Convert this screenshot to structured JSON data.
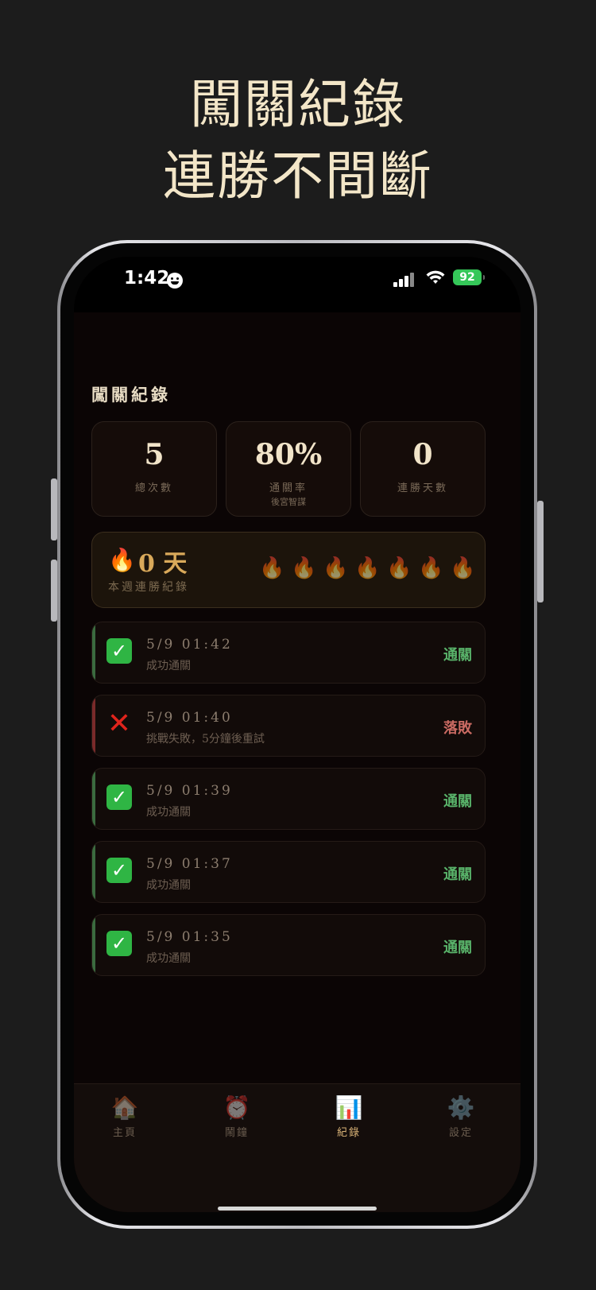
{
  "headline": {
    "line1": "闖關紀錄",
    "line2": "連勝不間斷"
  },
  "status_bar": {
    "time": "1:42",
    "battery": "92"
  },
  "page": {
    "title": "闖關紀錄"
  },
  "stats": [
    {
      "value": "5",
      "label": "總次數",
      "sub": ""
    },
    {
      "value": "80%",
      "label": "通關率",
      "sub": "後宮智謀"
    },
    {
      "value": "0",
      "label": "連勝天數",
      "sub": ""
    }
  ],
  "streak": {
    "icon": "🔥",
    "value": "0 天",
    "label": "本週連勝紀錄",
    "flames": [
      "🔥",
      "🔥",
      "🔥",
      "🔥",
      "🔥",
      "🔥",
      "🔥"
    ]
  },
  "records": [
    {
      "time": "5/9 01:42",
      "desc": "成功通關",
      "status": "通關",
      "icon": "✓"
    },
    {
      "time": "5/9 01:40",
      "desc": "挑戰失敗，5分鐘後重試",
      "status": "落敗",
      "icon": "✕"
    },
    {
      "time": "5/9 01:39",
      "desc": "成功通關",
      "status": "通關",
      "icon": "✓"
    },
    {
      "time": "5/9 01:37",
      "desc": "成功通關",
      "status": "通關",
      "icon": "✓"
    },
    {
      "time": "5/9 01:35",
      "desc": "成功通關",
      "status": "通關",
      "icon": "✓"
    }
  ],
  "tabs": [
    {
      "icon": "🏠",
      "label": "主頁"
    },
    {
      "icon": "⏰",
      "label": "鬧鐘"
    },
    {
      "icon": "📊",
      "label": "紀錄"
    },
    {
      "icon": "⚙️",
      "label": "設定"
    }
  ],
  "colors": {
    "accent": "#d8b277",
    "success": "#59b36a",
    "fail": "#c96a62"
  }
}
